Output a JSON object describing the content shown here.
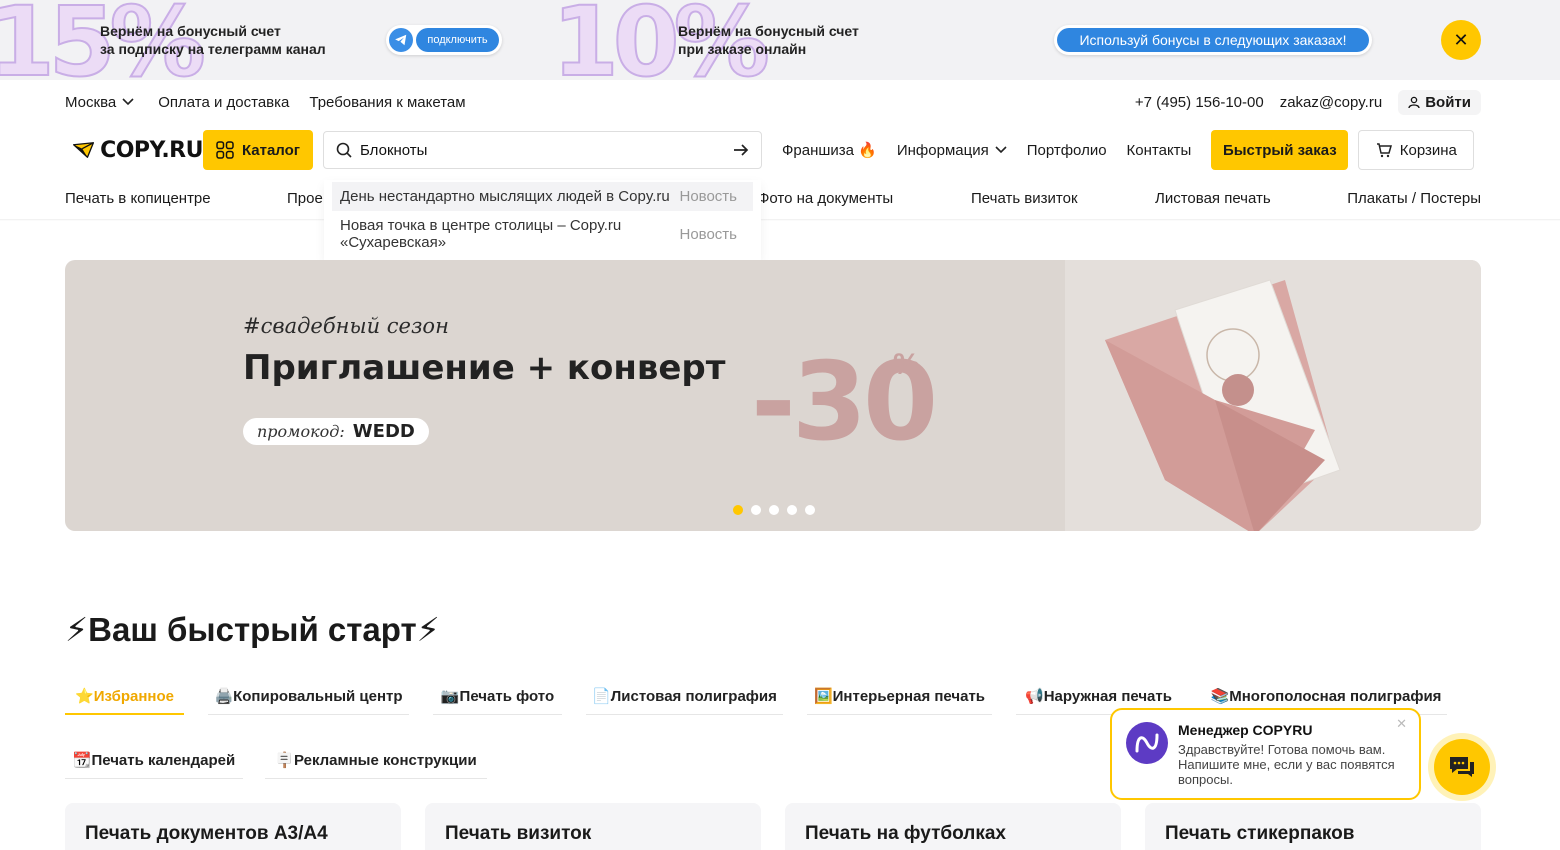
{
  "promo": {
    "big1": "15%",
    "text1_line1": "Вернём на бонусный счет",
    "text1_line2": "за подписку на телеграмм канал",
    "telegram_button": "подключить",
    "big2": "10%",
    "text2_line1": "Вернём на бонусный счет",
    "text2_line2": "при заказе онлайн",
    "bonus_button": "Используй бонусы в следующих заказах!",
    "close_icon": "close-icon"
  },
  "topbar": {
    "city": "Москва",
    "links": [
      "Оплата и доставка",
      "Требования к макетам"
    ],
    "phone": "+7 (495) 156-10-00",
    "email": "zakaz@copy.ru",
    "login": "Войти"
  },
  "header": {
    "logo": "COPY.RU",
    "catalog": "Каталог",
    "search_value": "Блокноты",
    "nav": [
      "Франшиза 🔥",
      "Информация",
      "Портфолио",
      "Контакты"
    ],
    "quick_order": "Быстрый заказ",
    "cart": "Корзина"
  },
  "categories": [
    "Печать в копицентре",
    "Прое",
    "Фото на документы",
    "Печать визиток",
    "Листовая печать",
    "Плакаты / Постеры"
  ],
  "dropdown": [
    {
      "title": "День нестандартно мыслящих людей в Copy.ru",
      "tag": "Новость"
    },
    {
      "title": "Новая точка в центре столицы – Copy.ru «Сухаревская»",
      "tag": "Новость"
    }
  ],
  "banner": {
    "hashtag": "#свадебный сезон",
    "headline": "Приглашение + конверт",
    "promo_label": "промокод:",
    "promo_code": "WEDD",
    "discount": "-30",
    "percent": "%",
    "slides": 5,
    "active_slide": 1
  },
  "quickstart": {
    "title": "⚡Ваш быстрый старт⚡",
    "tabs": [
      "⭐Избранное",
      "🖨️Копировальный центр",
      "📷Печать фото",
      "📄Листовая полиграфия",
      "🖼️Интерьерная печать",
      "📢Наружная печать",
      "📚Многополосная полиграфия",
      "📆Печать календарей",
      "🪧Рекламные конструкции"
    ],
    "active_tab": 0
  },
  "cards": [
    "Печать документов А3/А4",
    "Печать визиток",
    "Печать на футболках",
    "Печать стикерпаков"
  ],
  "chat": {
    "title": "Менеджер COPYRU",
    "message": "Здравствуйте! Готова помочь вам. Напишите мне, если у вас появятся вопросы.",
    "close": "✕"
  },
  "colors": {
    "accent": "#ffc700",
    "telegram_blue": "#2f86e0",
    "banner_bg": "#dcd6d1",
    "discount": "#c9a2a0"
  }
}
